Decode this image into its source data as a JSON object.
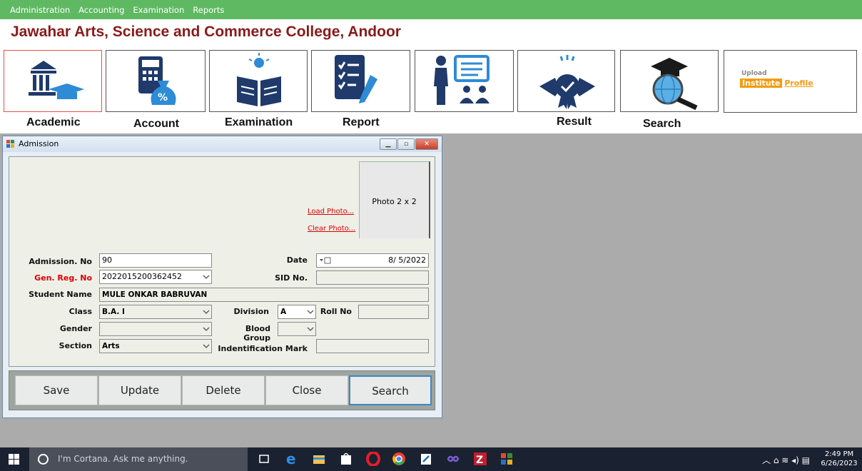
{
  "menu": [
    "Administration",
    "Accounting",
    "Examination",
    "Reports"
  ],
  "college_title": "Jawahar Arts, Science and Commerce College, Andoor",
  "tiles": [
    {
      "label": "Academic"
    },
    {
      "label": "Account"
    },
    {
      "label": "Examination"
    },
    {
      "label": "Report"
    },
    {
      "label": ""
    },
    {
      "label": "Result"
    },
    {
      "label": "Search"
    }
  ],
  "upload": {
    "line1": "Upload",
    "line2a": "Institute",
    "line2b": "Profile"
  },
  "window": {
    "title": "Admission",
    "photo_label": "Photo 2 x 2",
    "load_photo": "Load Photo...",
    "clear_photo": "Clear Photo...",
    "fields": {
      "admission_no": {
        "label": "Admission. No",
        "value": "90"
      },
      "date": {
        "label": "Date",
        "value": "8/ 5/2022"
      },
      "gen_reg_no": {
        "label": "Gen. Reg. No",
        "value": "2022015200362452"
      },
      "sid_no": {
        "label": "SID No.",
        "value": ""
      },
      "student_name": {
        "label": "Student Name",
        "value": "MULE ONKAR BABRUVAN"
      },
      "class": {
        "label": "Class",
        "value": "B.A. I"
      },
      "division": {
        "label": "Division",
        "value": "A"
      },
      "roll_no": {
        "label": "Roll No",
        "value": ""
      },
      "gender": {
        "label": "Gender",
        "value": ""
      },
      "blood_group": {
        "label": "Blood Group",
        "value": ""
      },
      "section": {
        "label": "Section",
        "value": "Arts"
      },
      "identification_mark": {
        "label": "Indentification Mark",
        "value": ""
      }
    },
    "buttons": {
      "save": "Save",
      "update": "Update",
      "delete": "Delete",
      "close": "Close",
      "search": "Search"
    }
  },
  "taskbar": {
    "cortana_placeholder": "I'm Cortana. Ask me anything.",
    "time": "2:49 PM",
    "date": "6/26/2023"
  },
  "colors": {
    "menubar": "#5fb962",
    "title": "#8b1a1a",
    "icon_navy": "#1f3a6b",
    "icon_blue": "#2e8bd6",
    "selected_button": "#3e86c5"
  }
}
